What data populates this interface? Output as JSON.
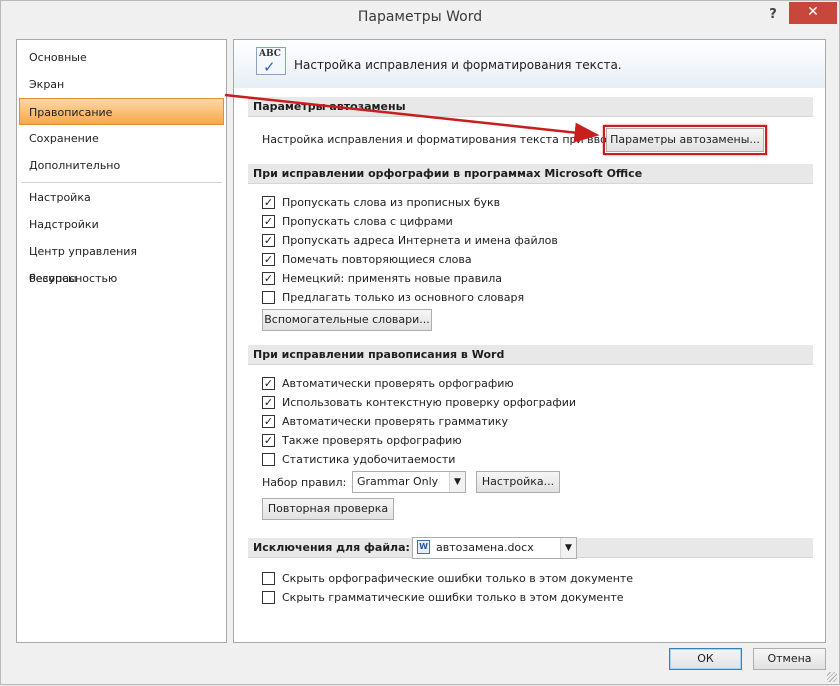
{
  "window": {
    "title": "Параметры Word",
    "help_label": "?",
    "close_label": "✕"
  },
  "sidebar": {
    "items": [
      {
        "label": "Основные"
      },
      {
        "label": "Экран"
      },
      {
        "label": "Правописание",
        "active": true
      },
      {
        "label": "Сохранение"
      },
      {
        "label": "Дополнительно"
      },
      {
        "label": "Настройка"
      },
      {
        "label": "Надстройки"
      },
      {
        "label": "Центр управления безопасностью"
      },
      {
        "label": "Ресурсы"
      }
    ]
  },
  "header": {
    "icon_text": "ABC",
    "title": "Настройка исправления и форматирования текста."
  },
  "autocorrect": {
    "heading": "Параметры автозамены",
    "label": "Настройка исправления и форматирования текста при вводе:",
    "button": "Параметры автозамены..."
  },
  "office_spelling": {
    "heading": "При исправлении орфографии в программах Microsoft Office",
    "options": [
      {
        "label": "Пропускать слова из прописных букв",
        "checked": true
      },
      {
        "label": "Пропускать слова с цифрами",
        "checked": true
      },
      {
        "label": "Пропускать адреса Интернета и имена файлов",
        "checked": true
      },
      {
        "label": "Помечать повторяющиеся слова",
        "checked": true
      },
      {
        "label": "Немецкий: применять новые правила",
        "checked": true
      },
      {
        "label": "Предлагать только из основного словаря",
        "checked": false
      }
    ],
    "dictionaries_button": "Вспомогательные словари..."
  },
  "word_spelling": {
    "heading": "При исправлении правописания в Word",
    "options": [
      {
        "label": "Автоматически проверять орфографию",
        "checked": true
      },
      {
        "label": "Использовать контекстную проверку орфографии",
        "checked": true
      },
      {
        "label": "Автоматически проверять грамматику",
        "checked": true
      },
      {
        "label": "Также проверять орфографию",
        "checked": true
      },
      {
        "label": "Статистика удобочитаемости",
        "checked": false
      }
    ],
    "rules_label": "Набор правил:",
    "rules_value": "Grammar Only",
    "settings_button": "Настройка...",
    "recheck_button": "Повторная проверка"
  },
  "exceptions": {
    "heading": "Исключения для файла:",
    "file_value": "автозамена.docx",
    "file_icon_text": "W",
    "options": [
      {
        "label": "Скрыть орфографические ошибки только в этом документе",
        "checked": false
      },
      {
        "label": "Скрыть грамматические ошибки только в этом документе",
        "checked": false
      }
    ]
  },
  "footer": {
    "ok": "ОК",
    "cancel": "Отмена"
  },
  "checkmark": "✓",
  "dropdown_arrow": "▼",
  "colors": {
    "active_nav": "#f6a84a",
    "highlight": "#c81e1e",
    "close_button": "#c7483a"
  }
}
